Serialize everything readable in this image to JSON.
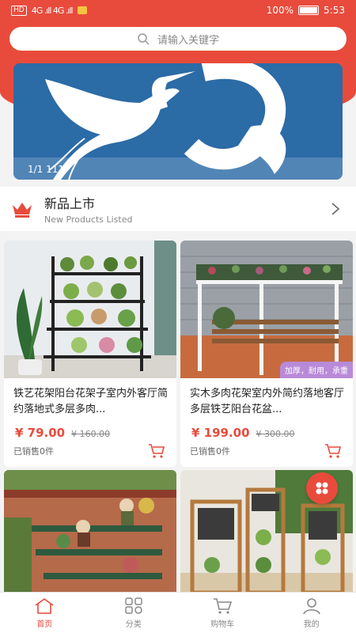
{
  "status_bar": {
    "left_chip": "HD",
    "signal": "4G .ıll 4G .ıll",
    "battery": "100%",
    "time": "5:53"
  },
  "search": {
    "placeholder": "请输入关键字"
  },
  "banner": {
    "counter": "1/1 111"
  },
  "section": {
    "title": "新品上市",
    "subtitle": "New Products Listed"
  },
  "products": [
    {
      "name": "铁艺花架阳台花架子室内外客厅简约落地式多层多肉...",
      "price": "¥ 79.00",
      "old_price": "¥ 160.00",
      "sold": "已销售0件"
    },
    {
      "name": "实木多肉花架室内外简约落地客厅多层铁艺阳台花盆...",
      "price": "¥ 199.00",
      "old_price": "¥ 300.00",
      "sold": "已销售0件",
      "tag": "加厚，耐用，承重"
    },
    {
      "name": "",
      "price": "",
      "old_price": "",
      "sold": ""
    },
    {
      "name": "",
      "price": "",
      "old_price": "",
      "sold": ""
    }
  ],
  "tabs": [
    {
      "label": "首页",
      "icon": "home-icon",
      "active": true
    },
    {
      "label": "分类",
      "icon": "category-icon",
      "active": false
    },
    {
      "label": "购物车",
      "icon": "cart-icon",
      "active": false
    },
    {
      "label": "我的",
      "icon": "user-icon",
      "active": false
    }
  ],
  "colors": {
    "accent": "#e84b3c",
    "tag": "#b88ad8"
  }
}
